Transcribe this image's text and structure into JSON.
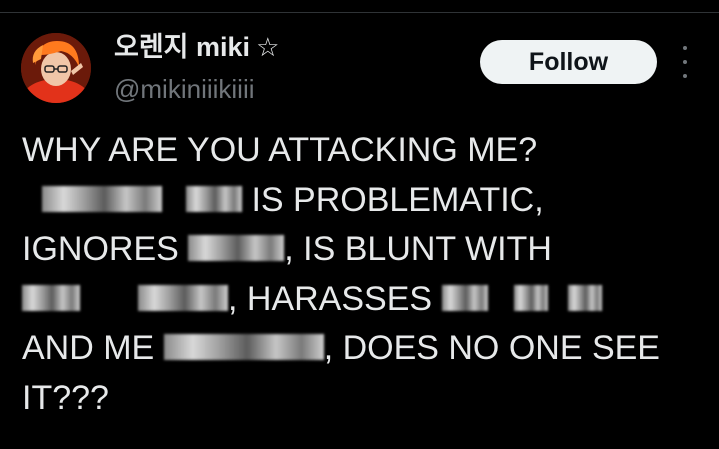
{
  "author": {
    "display_name": "오렌지 miki",
    "badge_icon": "star-outline-icon",
    "badge_glyph": "☆",
    "handle": "@mikiniiikiiii",
    "avatar_icon": "avatar-image"
  },
  "actions": {
    "follow_label": "Follow",
    "more_icon": "more-vertical-icon"
  },
  "tweet": {
    "lines": [
      "WHY ARE YOU ATTACKING ME?",
      "IS PROBLEMATIC,",
      "IGNORES",
      ", IS BLUNT WITH",
      ", HARASSES",
      "AND ME",
      ", DOES NO ONE SEE",
      "IT???"
    ]
  },
  "colors": {
    "background": "#000000",
    "text_primary": "#e7e9ea",
    "text_secondary": "#71767b",
    "button_bg": "#eff3f4",
    "button_text": "#0f1419"
  }
}
